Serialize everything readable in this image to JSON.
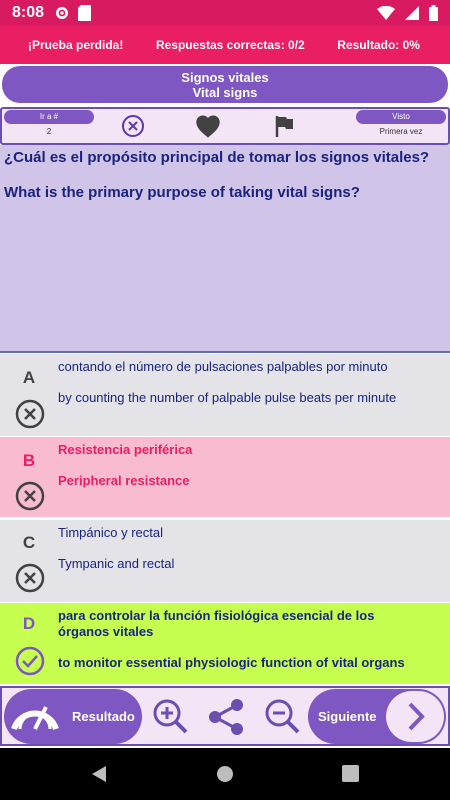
{
  "status": {
    "time": "8:08"
  },
  "score": {
    "lost": "¡Prueba perdida!",
    "correct": "Respuestas correctas: 0/2",
    "result": "Resultado: 0%"
  },
  "title": {
    "es": "Signos vitales",
    "en": "Vital signs"
  },
  "toolbar": {
    "goto_label": "Ir a #",
    "goto_value": "2",
    "seen_label": "Visto",
    "seen_value": "Primera vez"
  },
  "question": {
    "es": "¿Cuál es el propósito principal de tomar los signos vitales?",
    "en": "What is the primary purpose of taking vital signs?"
  },
  "answers": [
    {
      "letter": "A",
      "es": "contando el número de pulsaciones palpables por minuto",
      "en": "by counting the number of palpable pulse beats per minute",
      "state": "wrong"
    },
    {
      "letter": "B",
      "es": "Resistencia periférica",
      "en": "Peripheral resistance",
      "state": "selected-wrong"
    },
    {
      "letter": "C",
      "es": "Timpánico y rectal",
      "en": "Tympanic and rectal",
      "state": "wrong"
    },
    {
      "letter": "D",
      "es": "para controlar la función fisiológica esencial de los órganos vitales",
      "en": "to monitor essential physiologic function of vital organs",
      "state": "correct"
    }
  ],
  "bottom": {
    "result_label": "Resultado",
    "next_label": "Siguiente"
  },
  "colors": {
    "accent": "#7e57c2",
    "pink": "#e91e63",
    "correct": "#c6ff4f"
  }
}
